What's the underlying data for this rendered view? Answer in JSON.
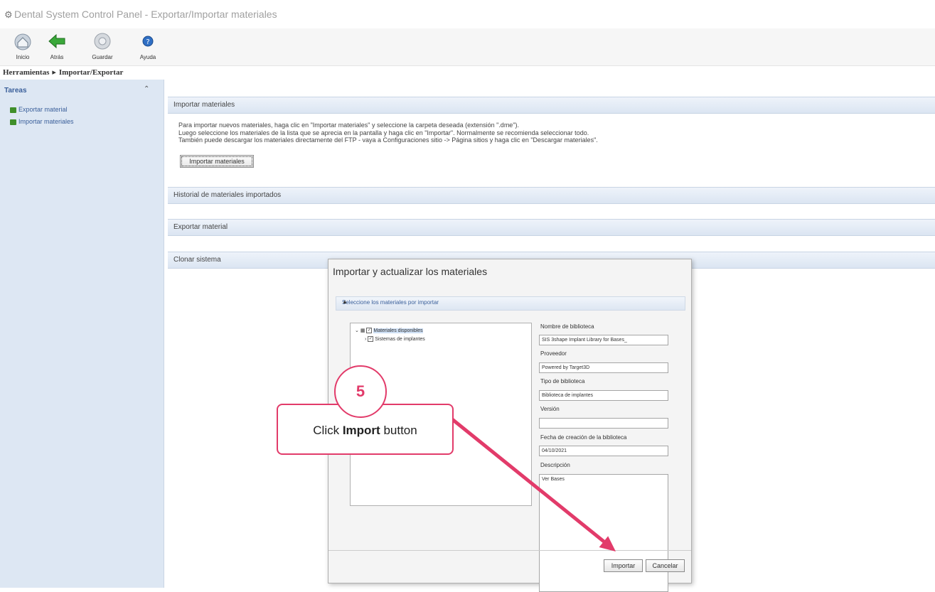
{
  "window": {
    "title": "Dental System Control Panel - Exportar/Importar materiales"
  },
  "toolbar": {
    "items": [
      {
        "label": "Inicio",
        "icon": "home-icon"
      },
      {
        "label": "Atrás",
        "icon": "back-arrow-icon"
      },
      {
        "label": "Guardar",
        "icon": "save-icon"
      },
      {
        "label": "Ayuda",
        "icon": "help-icon"
      }
    ]
  },
  "breadcrumb": {
    "root": "Herramientas",
    "separator": "▸",
    "current": "Importar/Exportar"
  },
  "tasks": {
    "header": "Tareas",
    "items": [
      "Exportar material",
      "Importar materiales"
    ]
  },
  "sections": {
    "import": "Importar materiales",
    "history": "Historial de materiales importados",
    "export": "Exportar material",
    "clone": "Clonar sistema"
  },
  "import_info": {
    "line1": "Para importar nuevos materiales, haga clic en \"Importar materiales\" y seleccione la carpeta deseada (extensión \".dme\").",
    "line2": "Luego seleccione los materiales de la lista que se aprecia en la pantalla y haga clic en \"Importar\". Normalmente se recomienda seleccionar todo.",
    "line3": "También puede descargar los materiales directamente del FTP - vaya a Configuraciones sitio -> Página sitios y haga clic en \"Descargar materiales\".",
    "button": "Importar materiales"
  },
  "dialog": {
    "title": "Importar y actualizar los materiales",
    "section": "Seleccione los materiales por importar",
    "tree": {
      "root": "Materiales disponibles",
      "child": "Sistemas de implantes"
    },
    "fields": {
      "library_name_label": "Nombre de biblioteca",
      "library_name_value": "SIS 3shape Implant Library for Bases_",
      "provider_label": "Proveedor",
      "provider_value": "Powered by Target3D",
      "type_label": "Tipo de biblioteca",
      "type_value": "Biblioteca de implantes",
      "version_label": "Versión",
      "version_value": "",
      "date_label": "Fecha de creación de la biblioteca",
      "date_value": "04/10/2021",
      "description_label": "Descripción",
      "description_value": "Ver Bases"
    },
    "import_button": "Importar",
    "cancel_button": "Cancelar"
  },
  "callout": {
    "step": "5",
    "prefix": "Click ",
    "bold": "Import",
    "suffix": " button",
    "color": "#e23b6a"
  }
}
